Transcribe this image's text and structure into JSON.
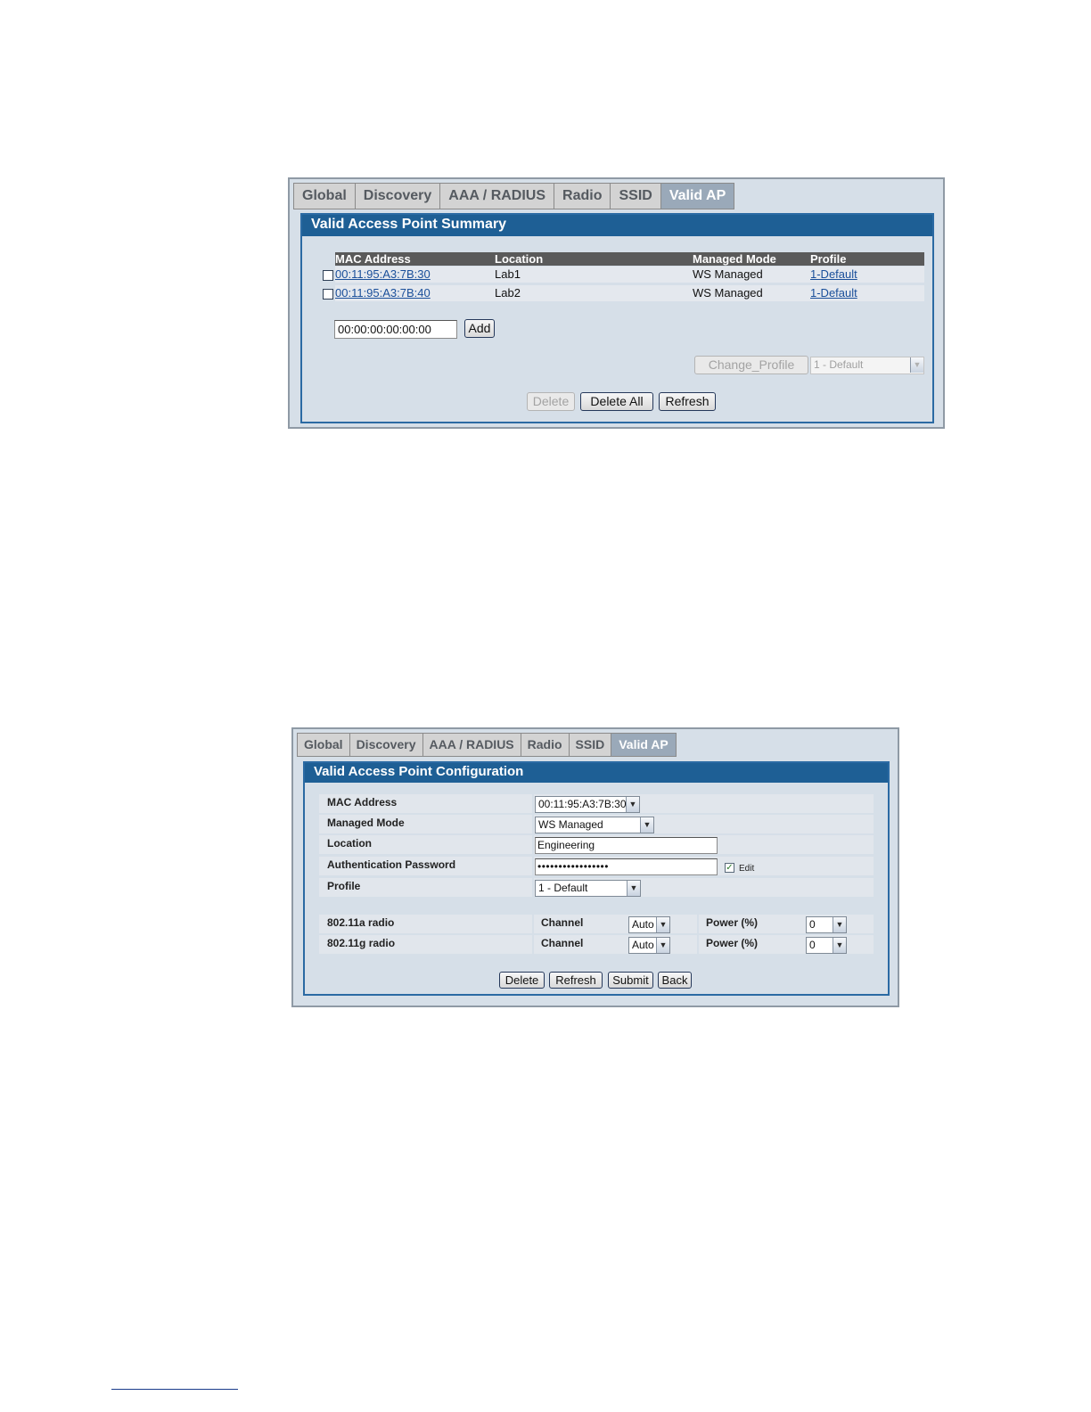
{
  "summary": {
    "tabs": [
      "Global",
      "Discovery",
      "AAA / RADIUS",
      "Radio",
      "SSID",
      "Valid AP"
    ],
    "active_tab": "Valid AP",
    "title": "Valid Access Point Summary",
    "columns": [
      "MAC Address",
      "Location",
      "Managed Mode",
      "Profile"
    ],
    "rows": [
      {
        "mac": "00:11:95:A3:7B:30",
        "location": "Lab1",
        "mode": "WS Managed",
        "profile": "1-Default"
      },
      {
        "mac": "00:11:95:A3:7B:40",
        "location": "Lab2",
        "mode": "WS Managed",
        "profile": "1-Default"
      }
    ],
    "mac_input_value": "00:00:00:00:00:00",
    "add_label": "Add",
    "change_profile_label": "Change_Profile",
    "profile_select_value": "1 - Default",
    "delete_label": "Delete",
    "delete_all_label": "Delete All",
    "refresh_label": "Refresh"
  },
  "config": {
    "tabs": [
      "Global",
      "Discovery",
      "AAA / RADIUS",
      "Radio",
      "SSID",
      "Valid AP"
    ],
    "active_tab": "Valid AP",
    "title": "Valid Access Point Configuration",
    "fields": {
      "mac_label": "MAC Address",
      "mac_value": "00:11:95:A3:7B:30",
      "mode_label": "Managed Mode",
      "mode_value": "WS Managed",
      "location_label": "Location",
      "location_value": "Engineering",
      "password_label": "Authentication Password",
      "password_value": "•••••••••••••••••",
      "edit_label": "Edit",
      "profile_label": "Profile",
      "profile_value": "1 - Default"
    },
    "radios": [
      {
        "name": "802.11a radio",
        "channel_label": "Channel",
        "channel_value": "Auto",
        "power_label": "Power (%)",
        "power_value": "0"
      },
      {
        "name": "802.11g radio",
        "channel_label": "Channel",
        "channel_value": "Auto",
        "power_label": "Power (%)",
        "power_value": "0"
      }
    ],
    "delete_label": "Delete",
    "refresh_label": "Refresh",
    "submit_label": "Submit",
    "back_label": "Back"
  }
}
